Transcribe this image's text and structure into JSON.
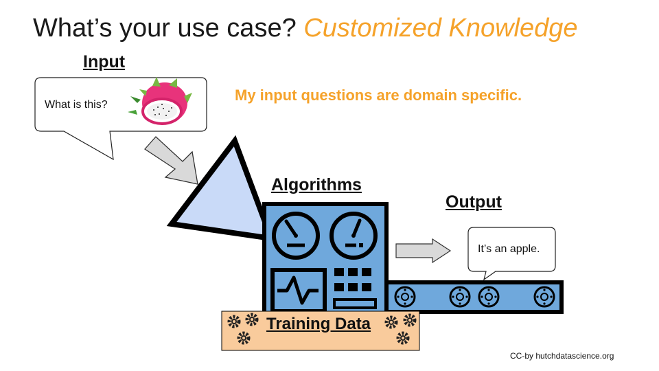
{
  "slide": {
    "title_main": "What’s your use case? ",
    "title_highlight": "Customized Knowledge",
    "subtitle": "My input questions are domain specific.",
    "credit": "CC-by hutchdatascience.org"
  },
  "labels": {
    "input": "Input",
    "algorithms": "Algorithms",
    "output": "Output",
    "training_data": "Training Data"
  },
  "bubbles": {
    "input_text": "What is this?",
    "output_text": "It’s an apple."
  },
  "colors": {
    "accent": "#f5a22a",
    "machine_blue": "#6fa8dc",
    "funnel_blue": "#c9daf8",
    "training_bg": "#f9cb9c"
  }
}
